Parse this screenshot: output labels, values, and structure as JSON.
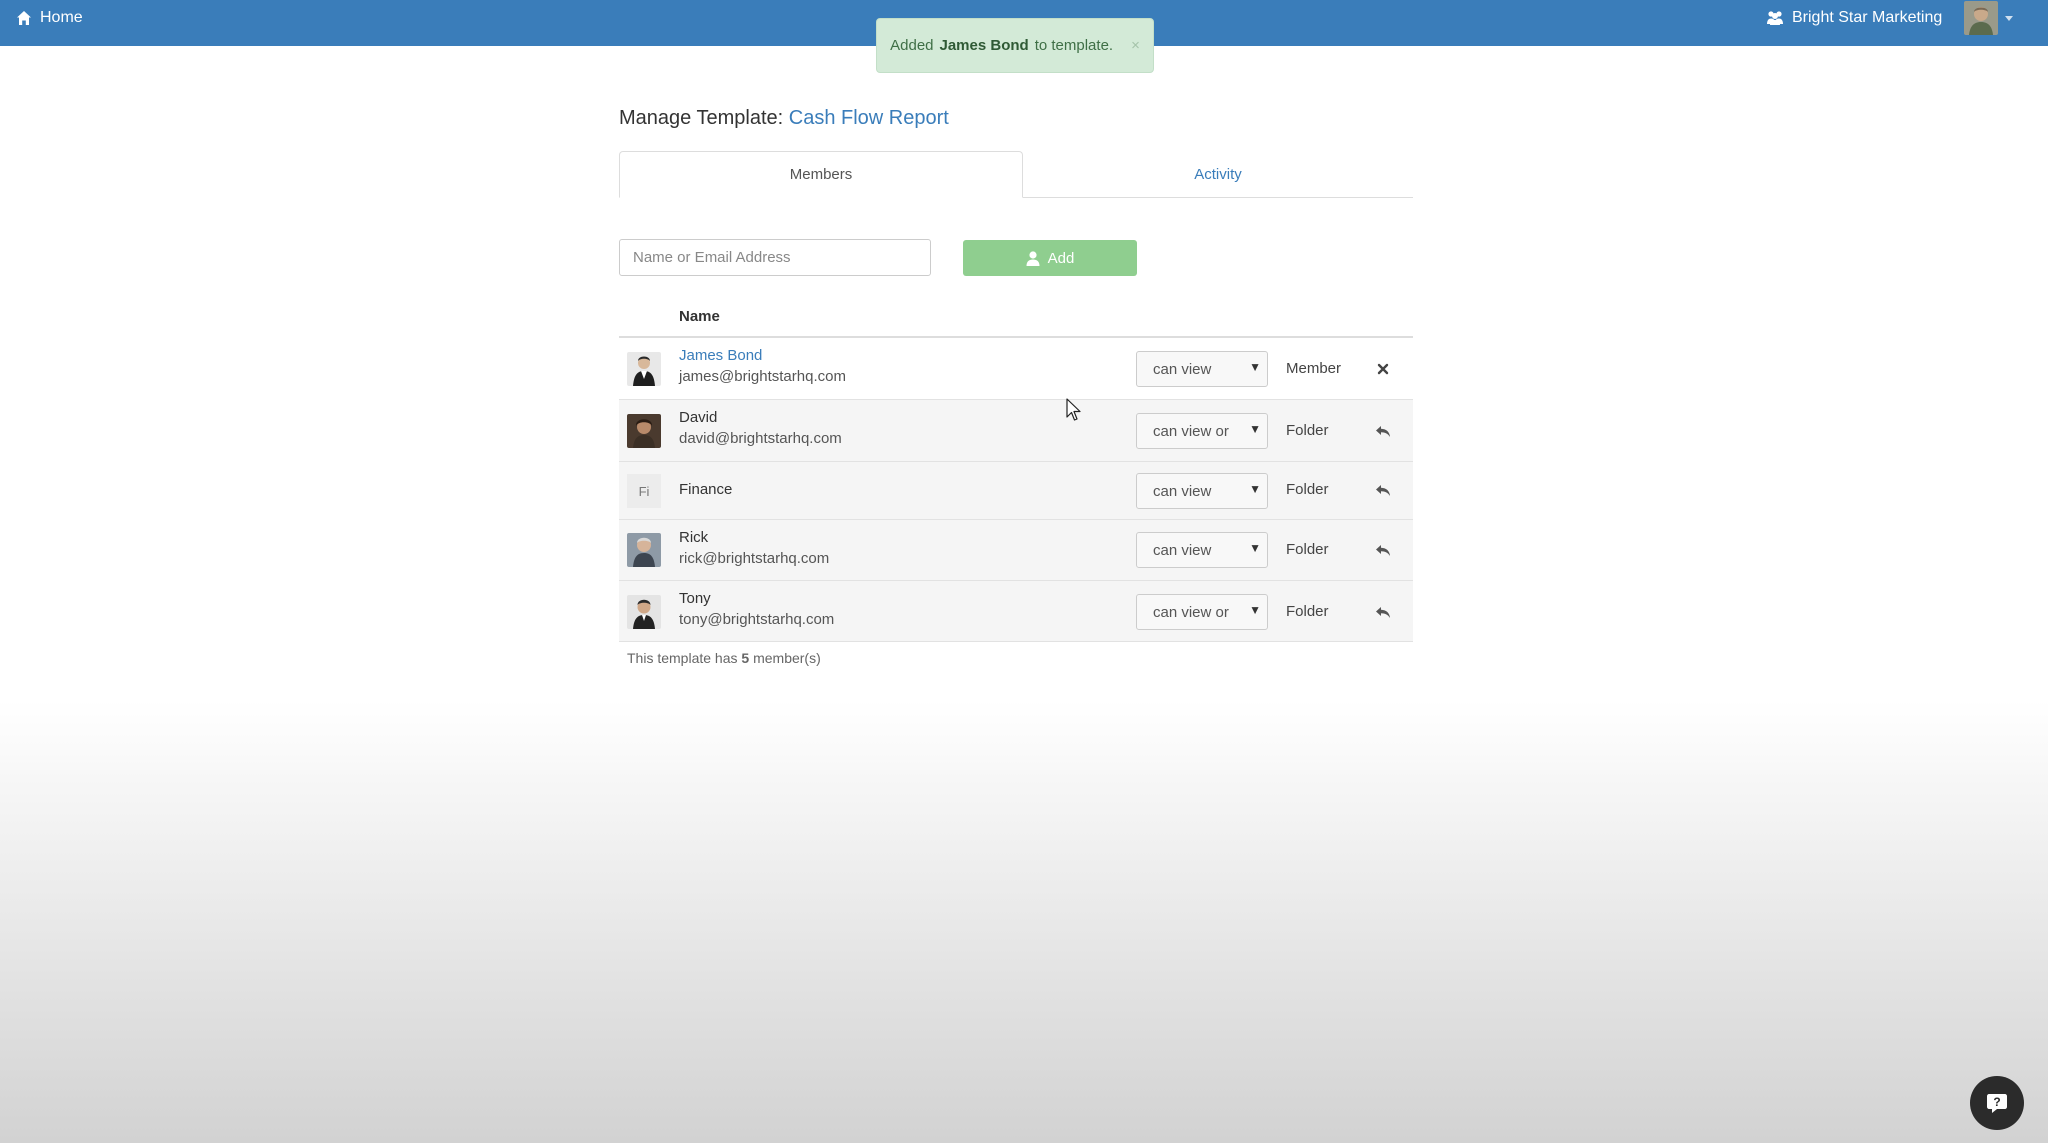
{
  "topbar": {
    "home_label": "Home",
    "company_name": "Bright Star Marketing"
  },
  "toast": {
    "prefix": "Added",
    "name": "James Bond",
    "suffix": "to template.",
    "close": "×"
  },
  "page": {
    "title_prefix": "Manage Template:",
    "template_name": "Cash Flow Report"
  },
  "tabs": [
    {
      "label": "Members",
      "active": true
    },
    {
      "label": "Activity",
      "active": false
    }
  ],
  "add_member": {
    "placeholder": "Name or Email Address",
    "button_label": "Add"
  },
  "table": {
    "column_name": "Name",
    "rows": [
      {
        "name": "James Bond",
        "email": "james@brightstarhq.com",
        "permission": "can view",
        "role": "Member",
        "action_icon": "remove-icon"
      },
      {
        "name": "David",
        "email": "david@brightstarhq.com",
        "permission": "can view or",
        "role": "Folder",
        "action_icon": "reply-icon"
      },
      {
        "name": "Finance",
        "initials": "Fi",
        "permission": "can view",
        "role": "Folder",
        "action_icon": "reply-icon"
      },
      {
        "name": "Rick",
        "email": "rick@brightstarhq.com",
        "permission": "can view",
        "role": "Folder",
        "action_icon": "reply-icon"
      },
      {
        "name": "Tony",
        "email": "tony@brightstarhq.com",
        "permission": "can view or",
        "role": "Folder",
        "action_icon": "reply-icon"
      }
    ]
  },
  "footer": {
    "prefix": "This template has",
    "count": "5",
    "suffix": "member(s)"
  },
  "colors": {
    "topbar": "#3a7dba",
    "link": "#3a7dba",
    "add_button": "#8fce8f",
    "toast_bg": "#d3ead7"
  }
}
